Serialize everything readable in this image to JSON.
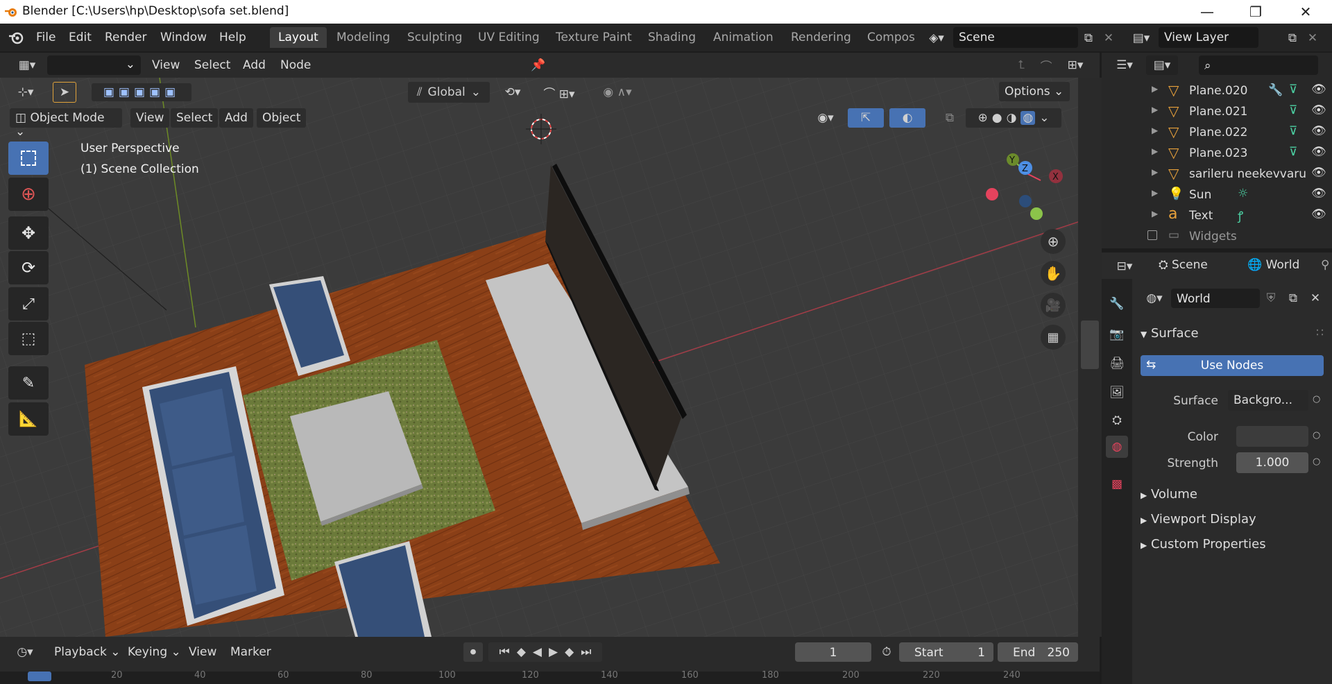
{
  "window": {
    "title": "Blender [C:\\Users\\hp\\Desktop\\sofa set.blend]",
    "minimize_glyph": "—",
    "restore_glyph": "❐",
    "close_glyph": "✕"
  },
  "menu": {
    "file": "File",
    "edit": "Edit",
    "render": "Render",
    "window": "Window",
    "help": "Help"
  },
  "workspaces": [
    "Layout",
    "Modeling",
    "Sculpting",
    "UV Editing",
    "Texture Paint",
    "Shading",
    "Animation",
    "Rendering",
    "Compos"
  ],
  "scene": {
    "label": "Scene",
    "view_layer": "View Layer"
  },
  "editor_header": {
    "view": "View",
    "select": "Select",
    "add": "Add",
    "node": "Node"
  },
  "viewport": {
    "header": {
      "transform_orientation": "Global",
      "options": "Options"
    },
    "mode": "Object Mode",
    "menus": {
      "view": "View",
      "select": "Select",
      "add": "Add",
      "object": "Object"
    },
    "overlay_text": {
      "line1": "User Perspective",
      "line2": "(1) Scene Collection"
    },
    "gizmo": {
      "x": "X",
      "y": "Y",
      "z": "Z"
    }
  },
  "outliner": {
    "items": [
      {
        "name": "Plane.020",
        "type": "mesh"
      },
      {
        "name": "Plane.021",
        "type": "mesh"
      },
      {
        "name": "Plane.022",
        "type": "mesh"
      },
      {
        "name": "Plane.023",
        "type": "mesh"
      },
      {
        "name": "sarileru neekevvaru",
        "type": "mesh"
      },
      {
        "name": "Sun",
        "type": "light"
      },
      {
        "name": "Text",
        "type": "text"
      },
      {
        "name": "Widgets",
        "type": "collection"
      }
    ]
  },
  "properties": {
    "tabs": {
      "scene": "Scene",
      "world": "World"
    },
    "world_name": "World",
    "surface_panel": "Surface",
    "use_nodes": "Use Nodes",
    "surface_label": "Surface",
    "surface_value": "Backgro...",
    "color_label": "Color",
    "strength_label": "Strength",
    "strength_value": "1.000",
    "panels": [
      "Volume",
      "Viewport Display",
      "Custom Properties"
    ]
  },
  "timeline": {
    "playback": "Playback",
    "keying": "Keying",
    "view": "View",
    "marker": "Marker",
    "current_frame": "1",
    "start_label": "Start",
    "start_value": "1",
    "end_label": "End",
    "end_value": "250",
    "ruler": [
      "20",
      "40",
      "60",
      "80",
      "100",
      "120",
      "140",
      "160",
      "180",
      "200",
      "220",
      "240"
    ]
  },
  "colors": {
    "accent": "#4772b3",
    "active_tool": "#4772b3",
    "x_axis": "#e5435d",
    "y_axis": "#8bc34a",
    "z_axis": "#4d8fe5",
    "mesh_icon": "#e8a13b"
  }
}
